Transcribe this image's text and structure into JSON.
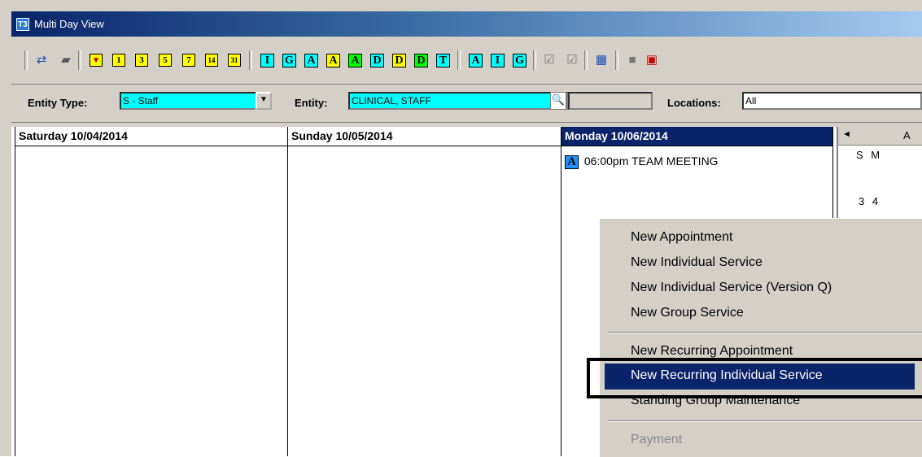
{
  "window": {
    "title": "Multi Day View",
    "icon": "T3"
  },
  "toolbar": {
    "number_buttons": [
      "1",
      "3",
      "5",
      "7",
      "14",
      "31"
    ],
    "letter_buttons_group1": [
      {
        "label": "I",
        "color": "#00ffff"
      },
      {
        "label": "G",
        "color": "#00ffff"
      },
      {
        "label": "A",
        "color": "#00ffff"
      },
      {
        "label": "A",
        "color": "#ffff00"
      },
      {
        "label": "A",
        "color": "#00ff00"
      },
      {
        "label": "D",
        "color": "#00ffff"
      },
      {
        "label": "D",
        "color": "#ffff00"
      },
      {
        "label": "D",
        "color": "#00ff00"
      },
      {
        "label": "T",
        "color": "#00ffff"
      }
    ],
    "letter_buttons_group2": [
      {
        "label": "A",
        "color": "#00ffff"
      },
      {
        "label": "I",
        "color": "#00ffff"
      },
      {
        "label": "G",
        "color": "#00ffff"
      }
    ]
  },
  "filters": {
    "entity_type_label": "Entity Type:",
    "entity_type_value": "S - Staff",
    "entity_label": "Entity:",
    "entity_value": "CLINICAL, STAFF",
    "locations_label": "Locations:",
    "locations_value": "All"
  },
  "days": [
    {
      "header": "Saturday 10/04/2014"
    },
    {
      "header": "Sunday 10/05/2014"
    },
    {
      "header": "Monday 10/06/2014"
    }
  ],
  "appointment": {
    "type": "A",
    "text": "06:00pm TEAM MEETING"
  },
  "mini_calendar": {
    "month_partial": "A",
    "weekday_letters": "S M",
    "dates": "3 4"
  },
  "context_menu": {
    "items": [
      "New Appointment",
      "New Individual Service",
      "New Individual Service (Version Q)",
      "New Group Service",
      "New Recurring Appointment",
      "New Recurring Individual Service",
      "Standing Group Maintenance",
      "Payment"
    ]
  }
}
